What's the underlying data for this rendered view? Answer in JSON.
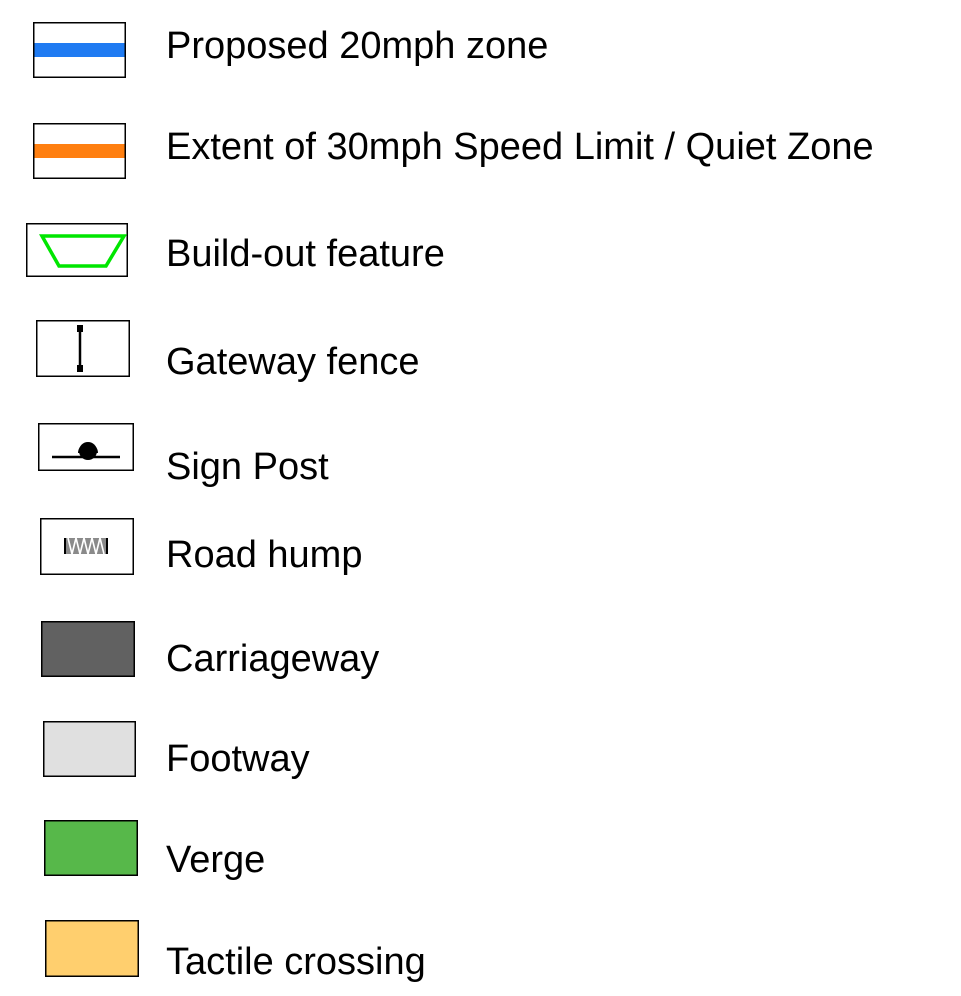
{
  "legend": {
    "items": [
      {
        "label": "Proposed 20mph zone",
        "icon": "blue-line-swatch",
        "color": "#1f7bf2"
      },
      {
        "label": "Extent of 30mph Speed Limit / Quiet Zone",
        "icon": "orange-line-swatch",
        "color": "#ff7f10"
      },
      {
        "label": "Build-out feature",
        "icon": "green-trapezoid-swatch",
        "color": "#00e600"
      },
      {
        "label": "Gateway fence",
        "icon": "gateway-fence-swatch",
        "color": "#000000"
      },
      {
        "label": "Sign Post",
        "icon": "sign-post-swatch",
        "color": "#000000"
      },
      {
        "label": "Road hump",
        "icon": "road-hump-swatch",
        "color": "#707070"
      },
      {
        "label": "Carriageway",
        "icon": "carriageway-swatch",
        "color": "#616161"
      },
      {
        "label": "Footway",
        "icon": "footway-swatch",
        "color": "#e0e0e0"
      },
      {
        "label": "Verge",
        "icon": "verge-swatch",
        "color": "#57b84a"
      },
      {
        "label": "Tactile crossing",
        "icon": "tactile-crossing-swatch",
        "color": "#ffcf6e"
      }
    ]
  }
}
